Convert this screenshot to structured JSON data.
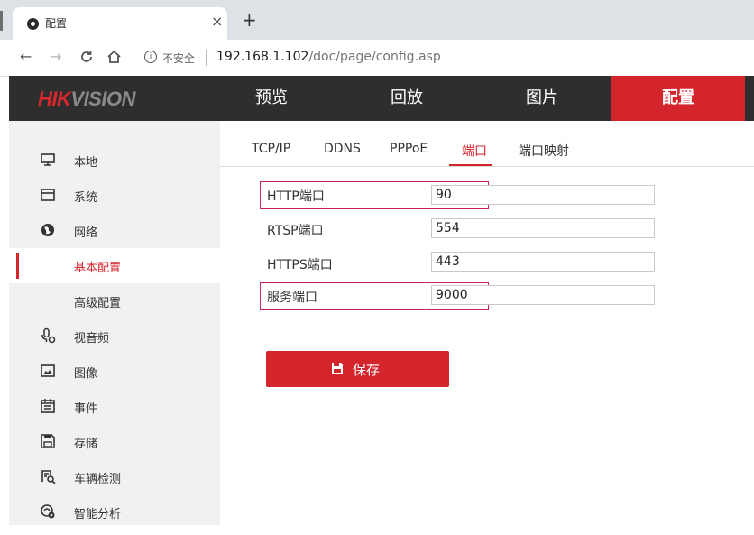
{
  "browser": {
    "tab_title": "配置",
    "tab_close": "×",
    "new_tab": "+",
    "security_label": "不安全",
    "url_host": "192.168.1.102",
    "url_path": "/doc/page/config.asp"
  },
  "topnav": {
    "logo_red": "HIK",
    "logo_gray": "VISION",
    "items": [
      {
        "label": "预览"
      },
      {
        "label": "回放"
      },
      {
        "label": "图片"
      },
      {
        "label": "配置",
        "active": true
      }
    ]
  },
  "sidebar": {
    "items": [
      {
        "label": "本地",
        "icon": "monitor-icon"
      },
      {
        "label": "系统",
        "icon": "window-icon"
      },
      {
        "label": "网络",
        "icon": "globe-icon"
      },
      {
        "label": "基本配置",
        "sub": true,
        "active": true
      },
      {
        "label": "高级配置",
        "sub": true
      },
      {
        "label": "视音频",
        "icon": "microphone-icon"
      },
      {
        "label": "图像",
        "icon": "image-icon"
      },
      {
        "label": "事件",
        "icon": "calendar-icon"
      },
      {
        "label": "存储",
        "icon": "floppy-icon"
      },
      {
        "label": "车辆检测",
        "icon": "vehicle-search-icon"
      },
      {
        "label": "智能分析",
        "icon": "smart-analysis-icon"
      }
    ]
  },
  "content": {
    "tabs": [
      {
        "label": "TCP/IP"
      },
      {
        "label": "DDNS"
      },
      {
        "label": "PPPoE"
      },
      {
        "label": "端口",
        "active": true
      },
      {
        "label": "端口映射"
      }
    ],
    "fields": [
      {
        "label": "HTTP端口",
        "value": "90",
        "highlighted": true
      },
      {
        "label": "RTSP端口",
        "value": "554"
      },
      {
        "label": "HTTPS端口",
        "value": "443"
      },
      {
        "label": "服务端口",
        "value": "9000",
        "highlighted": true
      }
    ],
    "save_label": "保存"
  },
  "colors": {
    "accent": "#d4242c",
    "nav_bg": "#2e2e2e",
    "sidebar_bg": "#f1f1f1",
    "highlight_border": "#c8245a"
  }
}
